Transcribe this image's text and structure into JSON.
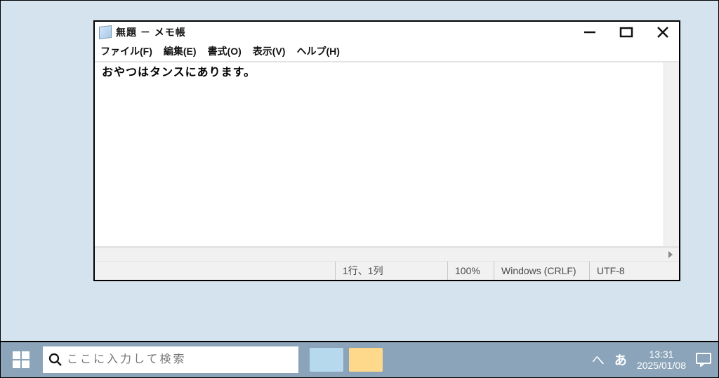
{
  "window": {
    "title": "無題 － メモ帳",
    "menu": {
      "file": "ファイル(F)",
      "edit": "編集(E)",
      "format": "書式(O)",
      "view": "表示(V)",
      "help": "ヘルプ(H)"
    },
    "content": "おやつはタンスにあります。",
    "status": {
      "position": "1行、1列",
      "zoom": "100%",
      "lineending": "Windows (CRLF)",
      "encoding": "UTF-8"
    }
  },
  "taskbar": {
    "search_placeholder": "ここに入力して検索",
    "ime": "あ",
    "chevron": "へ",
    "clock_time": "13:31",
    "clock_date": "2025/01/08"
  }
}
